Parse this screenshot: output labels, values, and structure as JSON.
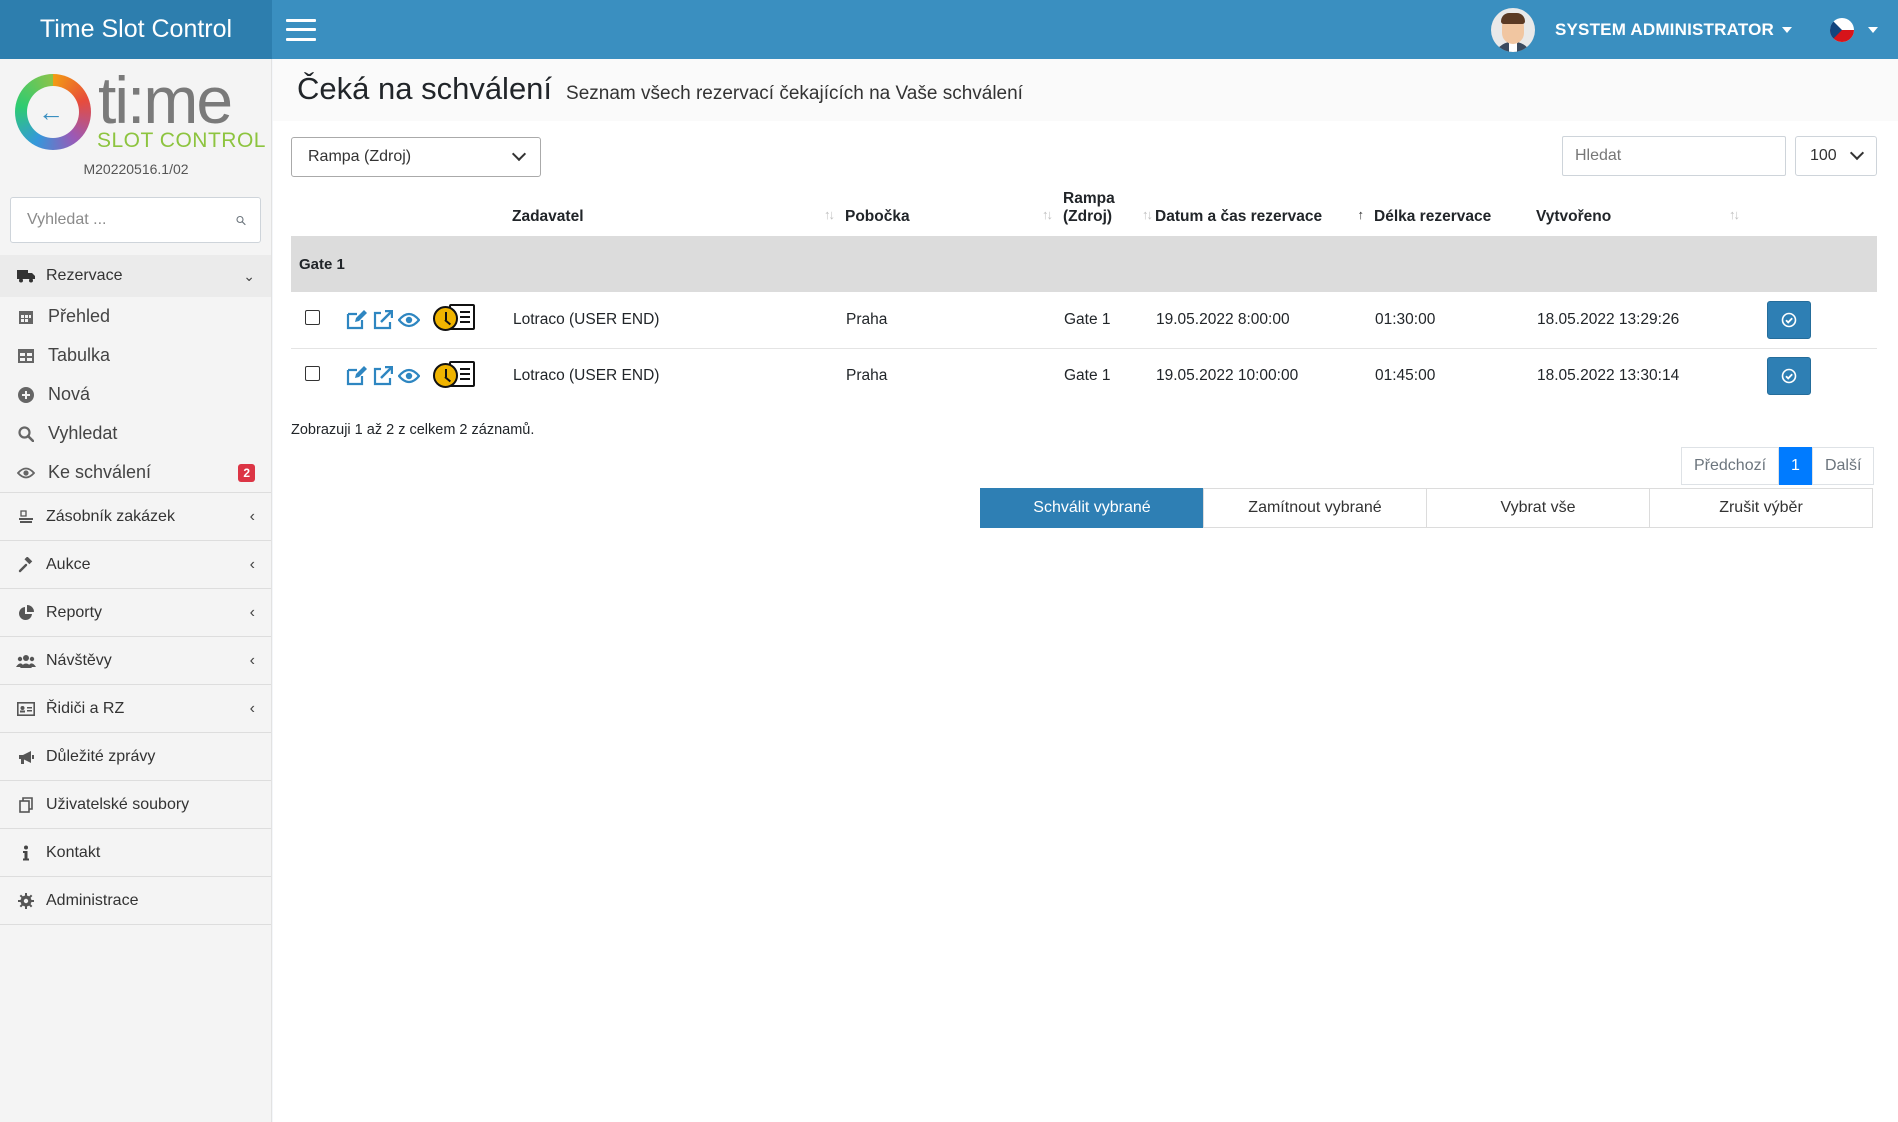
{
  "app": {
    "title": "Time Slot Control"
  },
  "user": {
    "name": "SYSTEM ADMINISTRATOR"
  },
  "logo": {
    "main": "ti:me",
    "sub": "SLOT CONTROL",
    "version": "M20220516.1/02"
  },
  "sidebar": {
    "search_placeholder": "Vyhledat ...",
    "reservations": {
      "label": "Rezervace",
      "children": [
        {
          "label": "Přehled",
          "icon": "calendar-icon"
        },
        {
          "label": "Tabulka",
          "icon": "table-icon"
        },
        {
          "label": "Nová",
          "icon": "plus-circle-icon"
        },
        {
          "label": "Vyhledat",
          "icon": "search-icon"
        },
        {
          "label": "Ke schválení",
          "icon": "eye-icon",
          "badge": "2"
        }
      ]
    },
    "items": [
      {
        "label": "Zásobník zakázek",
        "icon": "stack-icon",
        "expandable": true
      },
      {
        "label": "Aukce",
        "icon": "gavel-icon",
        "expandable": true
      },
      {
        "label": "Reporty",
        "icon": "pie-chart-icon",
        "expandable": true
      },
      {
        "label": "Návštěvy",
        "icon": "users-icon",
        "expandable": true
      },
      {
        "label": "Řidiči a RZ",
        "icon": "id-card-icon",
        "expandable": true
      },
      {
        "label": "Důležité zprávy",
        "icon": "megaphone-icon",
        "expandable": false
      },
      {
        "label": "Uživatelské soubory",
        "icon": "files-icon",
        "expandable": false
      },
      {
        "label": "Kontakt",
        "icon": "info-icon",
        "expandable": false
      },
      {
        "label": "Administrace",
        "icon": "gear-icon",
        "expandable": false
      }
    ]
  },
  "page": {
    "title": "Čeká na schválení",
    "subtitle": "Seznam všech rezervací čekajících na Vaše schválení"
  },
  "filters": {
    "ramp_select": "Rampa (Zdroj)",
    "search_placeholder": "Hledat",
    "page_size": "100"
  },
  "table": {
    "columns": {
      "zadavatel": "Zadavatel",
      "pobocka": "Pobočka",
      "rampa_line1": "Rampa",
      "rampa_line2": "(Zdroj)",
      "datum": "Datum a čas rezervace",
      "delka": "Délka rezervace",
      "vytvoreno": "Vytvořeno"
    },
    "group": "Gate 1",
    "rows": [
      {
        "zadavatel": "Lotraco (USER END)",
        "pobocka": "Praha",
        "rampa": "Gate 1",
        "datum": "19.05.2022 8:00:00",
        "delka": "01:30:00",
        "vytvoreno": "18.05.2022 13:29:26"
      },
      {
        "zadavatel": "Lotraco (USER END)",
        "pobocka": "Praha",
        "rampa": "Gate 1",
        "datum": "19.05.2022 10:00:00",
        "delka": "01:45:00",
        "vytvoreno": "18.05.2022 13:30:14"
      }
    ]
  },
  "info": "Zobrazuji 1 až 2 z celkem 2 záznamů.",
  "pagination": {
    "prev": "Předchozí",
    "current": "1",
    "next": "Další"
  },
  "bulk": {
    "approve": "Schválit vybrané",
    "reject": "Zamítnout vybrané",
    "select_all": "Vybrat vše",
    "clear": "Zrušit výběr"
  },
  "colors": {
    "navbar": "#3a8fc0",
    "brand": "#2d7eae",
    "primary_button": "#2e7fb4",
    "badge": "#dc3545",
    "page_active": "#007bff"
  }
}
